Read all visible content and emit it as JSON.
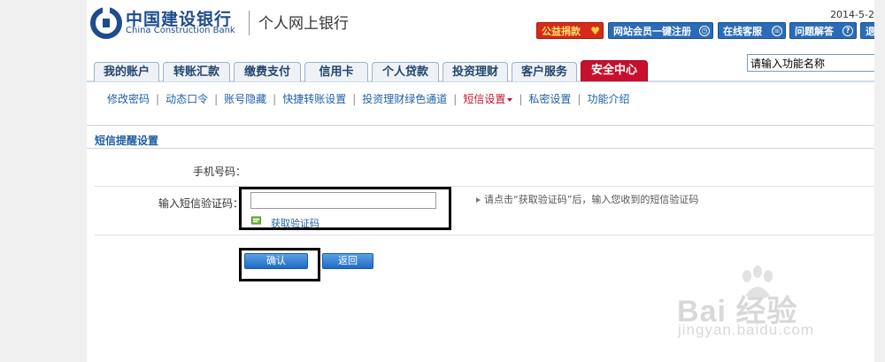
{
  "header": {
    "bank_name_cn": "中国建设银行",
    "bank_name_en": "China Construction Bank",
    "service_name": "个人网上银行",
    "date": "2014-5-2"
  },
  "top_buttons": {
    "charity": "公益捐款",
    "register": "网站会员一键注册",
    "online_service": "在线客服",
    "faq": "问题解答",
    "exit": "退"
  },
  "search": {
    "value": "请输入功能名称"
  },
  "tabs": [
    {
      "label": "我的账户"
    },
    {
      "label": "转账汇款"
    },
    {
      "label": "缴费支付"
    },
    {
      "label": "信用卡"
    },
    {
      "label": "个人贷款"
    },
    {
      "label": "投资理财"
    },
    {
      "label": "客户服务"
    },
    {
      "label": "安全中心"
    }
  ],
  "active_tab": "安全中心",
  "subnav": [
    {
      "label": "修改密码"
    },
    {
      "label": "动态口令"
    },
    {
      "label": "账号隐藏"
    },
    {
      "label": "快捷转账设置"
    },
    {
      "label": "投资理财绿色通道"
    },
    {
      "label": "短信设置"
    },
    {
      "label": "私密设置"
    },
    {
      "label": "功能介绍"
    }
  ],
  "form": {
    "section_title": "短信提醒设置",
    "phone_label": "手机号码：",
    "code_label": "输入短信验证码：",
    "code_value": "",
    "get_code_link": "获取验证码",
    "hint": "请点击“获取验证码”后，输入您收到的短信验证码",
    "confirm_label": "确认",
    "back_label": "返回"
  },
  "watermark": {
    "brand": "Bai 经验",
    "url": "jingyan.baidu.com"
  },
  "colors": {
    "brand_blue": "#1e4c8e",
    "active_tab_red": "#c8102e",
    "link_blue": "#1f5fa6",
    "button_blue": "#2b6cb8"
  }
}
